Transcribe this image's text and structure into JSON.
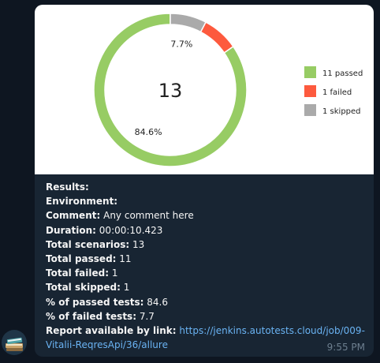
{
  "chart_data": {
    "type": "pie",
    "center_label": "13",
    "slices": [
      {
        "label": "11 passed",
        "value": 11,
        "pct_label": "84.6%",
        "color": "#97cc64"
      },
      {
        "label": "1 failed",
        "value": 1,
        "pct_label": "",
        "color": "#fd5a3e"
      },
      {
        "label": "1 skipped",
        "value": 1,
        "pct_label": "7.7%",
        "color": "#aaaaaa"
      }
    ],
    "legend_position": "right"
  },
  "message": {
    "lines": [
      {
        "label": "Results:",
        "value": ""
      },
      {
        "label": "Environment:",
        "value": ""
      },
      {
        "label": "Comment:",
        "value": "Any comment here"
      },
      {
        "label": "Duration:",
        "value": "00:00:10.423"
      },
      {
        "label": "Total scenarios:",
        "value": "13"
      },
      {
        "label": "Total passed:",
        "value": "11"
      },
      {
        "label": "Total failed:",
        "value": "1"
      },
      {
        "label": "Total skipped:",
        "value": "1"
      },
      {
        "label": "% of passed tests:",
        "value": "84.6"
      },
      {
        "label": "% of failed tests:",
        "value": "7.7"
      }
    ],
    "report_label": "Report available by link:",
    "report_link": "https://jenkins.autotests.cloud/job/009-Vitalii-ReqresApi/36/allure",
    "time": "9:55 PM"
  },
  "avatar": {
    "icon": "book-stack-icon"
  }
}
